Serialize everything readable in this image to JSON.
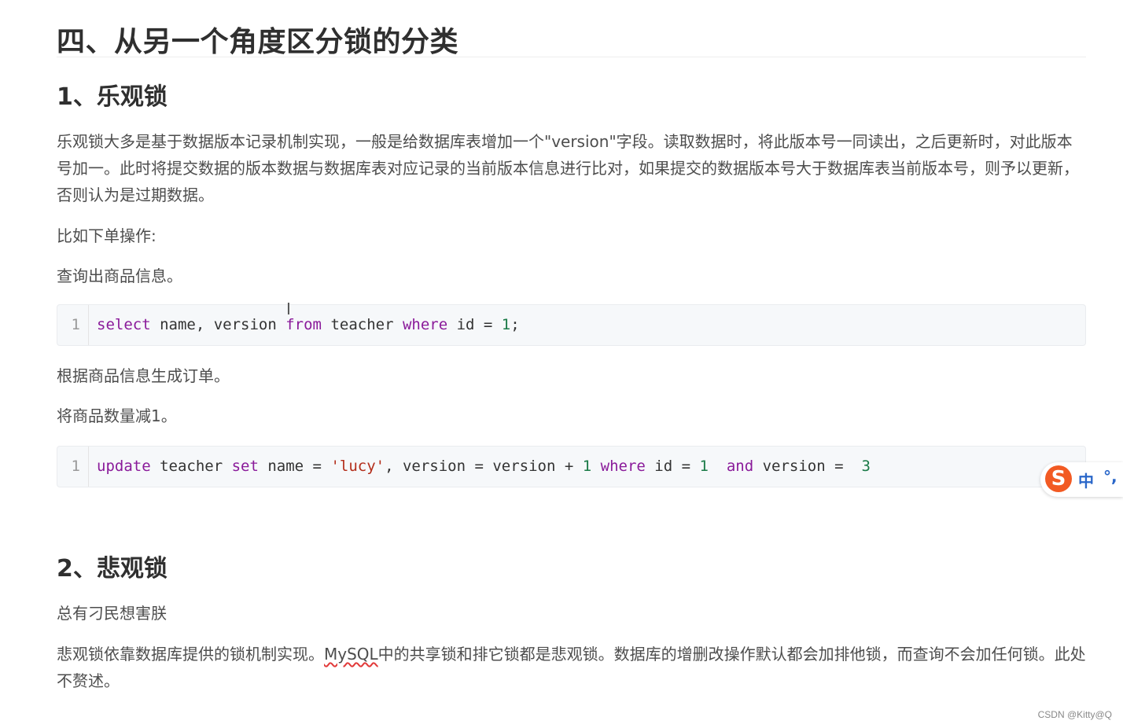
{
  "article": {
    "section_title": "四、从另一个角度区分锁的分类",
    "optimistic": {
      "heading": "1、乐观锁",
      "description": "乐观锁大多是基于数据版本记录机制实现，一般是给数据库表增加一个\"version\"字段。读取数据时，将此版本号一同读出，之后更新时，对此版本号加一。此时将提交数据的版本数据与数据库表对应记录的当前版本信息进行比对，如果提交的数据版本号大于数据库表当前版本号，则予以更新，否则认为是过期数据。",
      "example_intro": "比如下单操作:",
      "step1": "查询出商品信息。",
      "code1": {
        "line_number": "1",
        "tokens": [
          "select",
          " name, version ",
          "from",
          " teacher ",
          "where",
          " id = ",
          "1",
          ";"
        ]
      },
      "step2": "根据商品信息生成订单。",
      "step3": "将商品数量减1。",
      "code2": {
        "line_number": "1",
        "tokens": [
          "update",
          " teacher ",
          "set",
          " name = ",
          "'lucy'",
          ", version = version + ",
          "1",
          " ",
          "where",
          " id = ",
          "1",
          "  ",
          "and",
          " version =  ",
          "3"
        ]
      }
    },
    "pessimistic": {
      "heading": "2、悲观锁",
      "note": "总有刁民想害朕",
      "desc_before": "悲观锁依靠数据库提供的锁机制实现。",
      "desc_mysql": "MySQL",
      "desc_after": "中的共享锁和排它锁都是悲观锁。数据库的增删改操作默认都会加排他锁，而查询不会加任何锁。此处不赘述。"
    }
  },
  "text_cursor": "I",
  "ime_toolbar": {
    "logo": "S",
    "mode": "中",
    "punct": "°,"
  },
  "watermark": "CSDN @Kitty@Q",
  "colors": {
    "keyword": "#8a1a9a",
    "number": "#1a7a47",
    "string": "#b32d1a",
    "code_bg": "#f6f8fa",
    "ime_logo": "#f25a23"
  }
}
